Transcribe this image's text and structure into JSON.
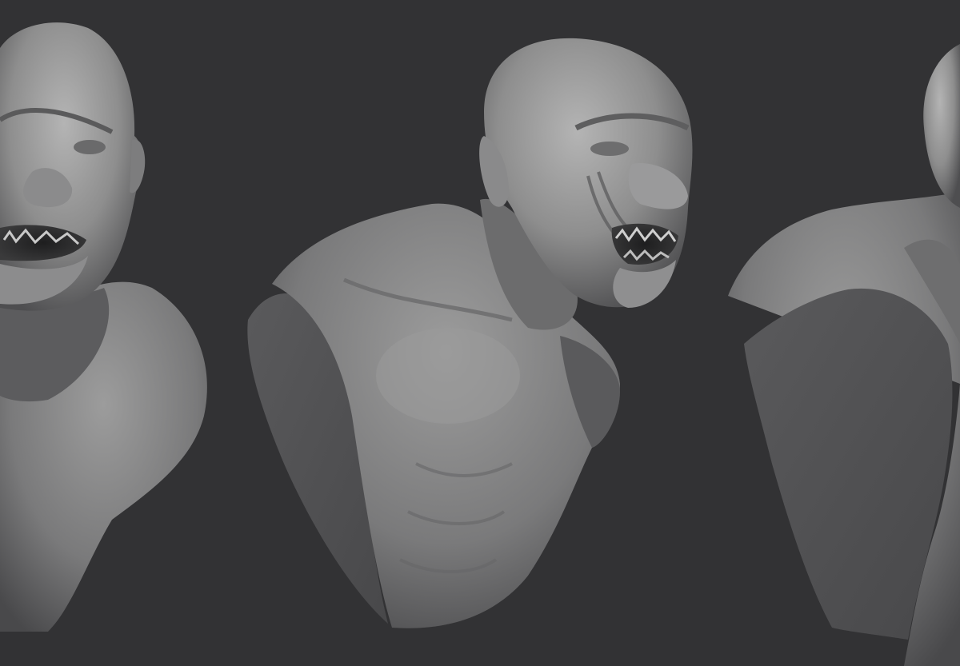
{
  "scene": {
    "background_color": "#323234",
    "material_color": "#8a8a8a",
    "cut_face_color": "#545456",
    "views": [
      {
        "name": "front-view"
      },
      {
        "name": "three-quarter-view"
      },
      {
        "name": "back-view"
      }
    ]
  }
}
